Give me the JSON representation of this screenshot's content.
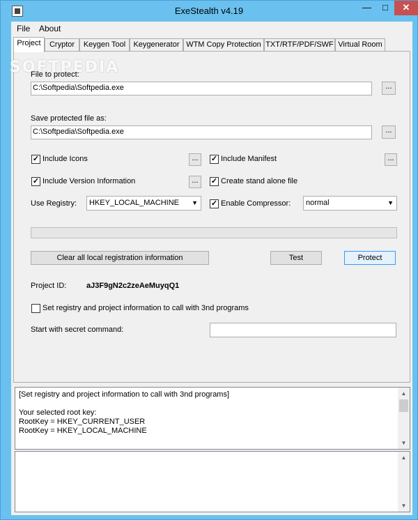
{
  "window": {
    "title": "ExeStealth v4.19",
    "minimize": "—",
    "maximize": "□",
    "close": "✕"
  },
  "menu": [
    "File",
    "About"
  ],
  "tabs": [
    "Project",
    "Cryptor",
    "Keygen Tool",
    "Keygenerator",
    "WTM Copy Protection",
    "TXT/RTF/PDF/SWF",
    "Virtual Room"
  ],
  "watermark": "SOFTPEDIA",
  "project": {
    "file_to_protect_label": "File to protect:",
    "file_to_protect_value": "C:\\Softpedia\\Softpedia.exe",
    "save_as_label": "Save protected file as:",
    "save_as_value": "C:\\Softpedia\\Softpedia.exe",
    "browse_label": "...",
    "include_icons": "Include Icons",
    "include_manifest": "Include Manifest",
    "include_version": "Include Version Information",
    "create_standalone": "Create stand alone file",
    "use_registry_label": "Use Registry:",
    "registry_value": "HKEY_LOCAL_MACHINE",
    "enable_compressor": "Enable Compressor:",
    "compressor_value": "normal",
    "progress_fraction": 0,
    "clear_button": "Clear all local registration information",
    "test_button": "Test",
    "protect_button": "Protect",
    "project_id_label": "Project ID:",
    "project_id_value": "aJ3F9gN2c2zeAeMuyqQ1",
    "set_registry_label": "Set registry and project information to call with 3nd programs",
    "secret_command_label": "Start with secret command:",
    "secret_command_value": "",
    "check_mark": "✓"
  },
  "log": {
    "lines": [
      "[Set registry and project information to call with 3nd programs]",
      "",
      "Your selected root key:",
      "RootKey = HKEY_CURRENT_USER",
      "RootKey = HKEY_LOCAL_MACHINE"
    ],
    "scroll_up": "▲",
    "scroll_down": "▼"
  }
}
